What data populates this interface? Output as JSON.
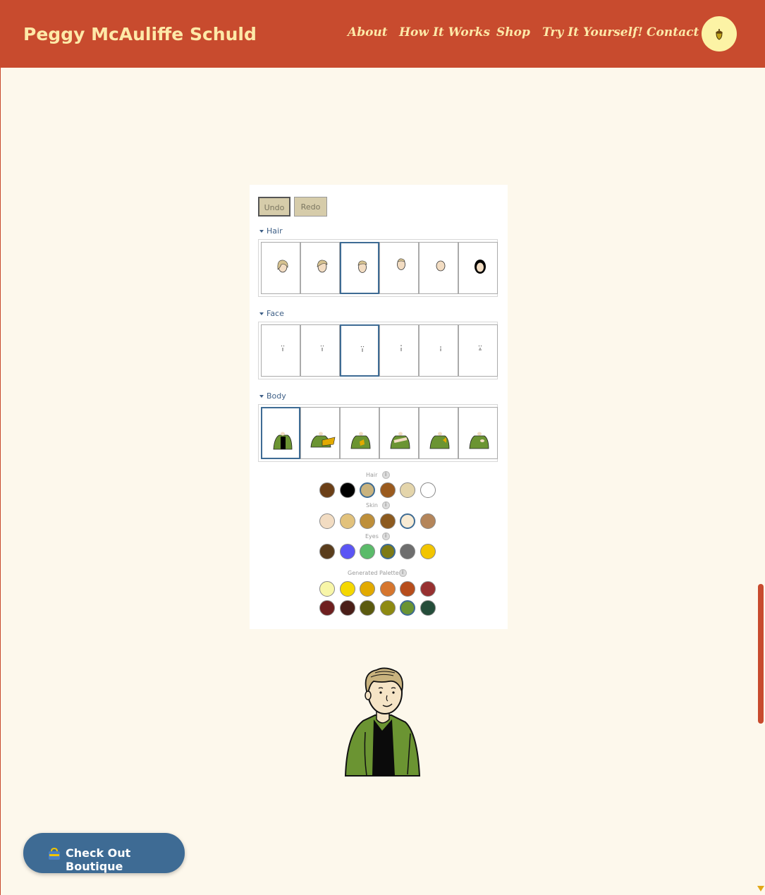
{
  "header": {
    "brand": "Peggy McAuliffe Schuld",
    "nav": [
      {
        "label": "About"
      },
      {
        "label": "How It Works"
      },
      {
        "label": "Shop"
      },
      {
        "label": "Try It Yourself!"
      },
      {
        "label": "Contact"
      }
    ],
    "avatar_icon": "acorn-icon"
  },
  "editor": {
    "undo_label": "Undo",
    "redo_label": "Redo",
    "sections": [
      {
        "label": "Hair",
        "selected_index": 2
      },
      {
        "label": "Face",
        "selected_index": 2
      },
      {
        "label": "Body",
        "selected_index": 0
      }
    ],
    "palettes": {
      "hair": {
        "label": "Hair",
        "colors": [
          "#6b3f17",
          "#000000",
          "#c9b37e",
          "#9a5a1e",
          "#e4d5ab",
          "#ffffff"
        ],
        "selected": 2
      },
      "skin": {
        "label": "Skin",
        "colors": [
          "#f2dcc2",
          "#e2c27c",
          "#be8f3a",
          "#8c5a1f",
          "#f8ebd4",
          "#b4855a"
        ],
        "selected": 4
      },
      "eyes": {
        "label": "Eyes",
        "colors": [
          "#5a3d1c",
          "#5b55f5",
          "#5bbb6a",
          "#7d7a16",
          "#6e6e6e",
          "#f2c500"
        ],
        "selected": 3
      },
      "generated": {
        "label": "Generated Palette",
        "colors": [
          "#f8f6a8",
          "#f5d800",
          "#e2aa00",
          "#d6762e",
          "#b74d1c",
          "#973030",
          "#6e1f1f",
          "#4a1e18",
          "#5b5a0f",
          "#8e8a12",
          "#6b9432",
          "#254d3a"
        ],
        "selected": 10
      }
    }
  },
  "boutique": {
    "label": "Check Out Boutique",
    "icon": "shopping-bag-icon"
  },
  "colors": {
    "header": "#c84b2e",
    "nav_text": "#fde9a8",
    "accent": "#3e6b94",
    "background": "#fdf8ec"
  }
}
